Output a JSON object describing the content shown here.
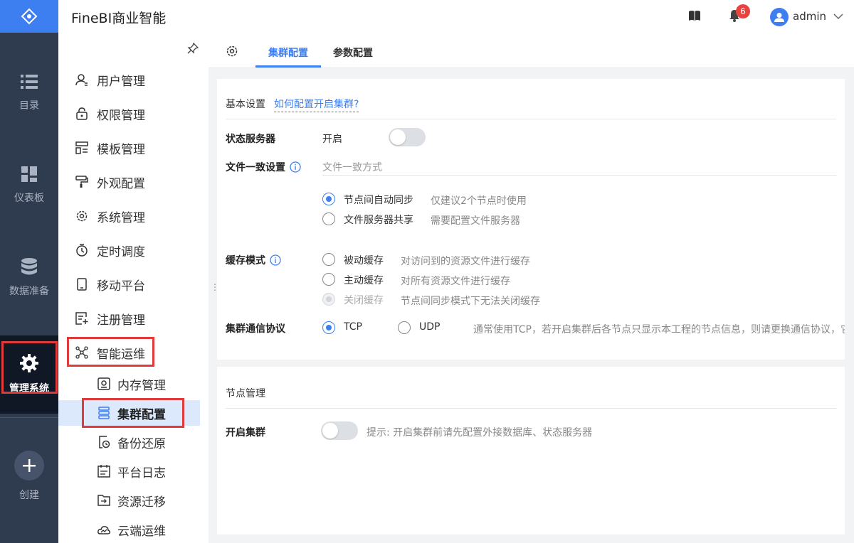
{
  "app": {
    "title": "FineBI商业智能"
  },
  "colors": {
    "accent": "#3d7ff0",
    "rail_bg": "#2f3b4e",
    "highlight_box": "#e03a3a",
    "badge": "#e8433e"
  },
  "rail": {
    "items": [
      {
        "label": "目录",
        "icon": "list-icon"
      },
      {
        "label": "仪表板",
        "icon": "dashboard-icon"
      },
      {
        "label": "数据准备",
        "icon": "database-icon"
      },
      {
        "label": "管理系统",
        "icon": "gear-icon",
        "active": true
      },
      {
        "label": "创建",
        "icon": "plus-icon"
      }
    ]
  },
  "header": {
    "notification_count": "6",
    "user": "admin"
  },
  "menu": {
    "items": [
      {
        "label": "用户管理",
        "icon": "user-icon"
      },
      {
        "label": "权限管理",
        "icon": "lock-icon"
      },
      {
        "label": "模板管理",
        "icon": "template-icon"
      },
      {
        "label": "外观配置",
        "icon": "paint-roller-icon"
      },
      {
        "label": "系统管理",
        "icon": "gear-icon"
      },
      {
        "label": "定时调度",
        "icon": "timer-icon"
      },
      {
        "label": "移动平台",
        "icon": "mobile-icon"
      },
      {
        "label": "注册管理",
        "icon": "register-icon"
      },
      {
        "label": "智能运维",
        "icon": "network-icon",
        "expanded": true
      }
    ],
    "children": [
      {
        "label": "内存管理",
        "icon": "memory-icon"
      },
      {
        "label": "集群配置",
        "icon": "cluster-icon",
        "selected": true
      },
      {
        "label": "备份还原",
        "icon": "backup-icon"
      },
      {
        "label": "平台日志",
        "icon": "log-icon"
      },
      {
        "label": "资源迁移",
        "icon": "migrate-icon"
      },
      {
        "label": "云端运维",
        "icon": "cloud-icon"
      }
    ]
  },
  "tabs": {
    "items": [
      "集群配置",
      "参数配置"
    ],
    "active": "集群配置"
  },
  "basic": {
    "title": "基本设置",
    "help_link": "如何配置开启集群?",
    "state_server": {
      "label": "状态服务器",
      "value": "开启",
      "enabled": false
    },
    "file_consistency": {
      "label": "文件一致设置",
      "sub_label": "文件一致方式",
      "options": [
        {
          "label": "节点间自动同步",
          "hint": "仅建议2个节点时使用",
          "checked": true
        },
        {
          "label": "文件服务器共享",
          "hint": "需要配置文件服务器",
          "checked": false
        }
      ]
    },
    "cache_mode": {
      "label": "缓存模式",
      "options": [
        {
          "label": "被动缓存",
          "hint": "对访问到的资源文件进行缓存",
          "checked": false
        },
        {
          "label": "主动缓存",
          "hint": "对所有资源文件进行缓存",
          "checked": false
        },
        {
          "label": "关闭缓存",
          "hint": "节点间同步模式下无法关闭缓存",
          "checked": true,
          "disabled": true
        }
      ]
    },
    "protocol": {
      "label": "集群通信协议",
      "options": [
        {
          "label": "TCP",
          "checked": true
        },
        {
          "label": "UDP",
          "checked": false
        }
      ],
      "hint": "通常使用TCP，若开启集群后各节点只显示本工程的节点信息，则请更换通信协议，它"
    }
  },
  "nodes": {
    "title": "节点管理",
    "enable_cluster": {
      "label": "开启集群",
      "enabled": false,
      "hint": "提示: 开启集群前请先配置外接数据库、状态服务器"
    }
  }
}
